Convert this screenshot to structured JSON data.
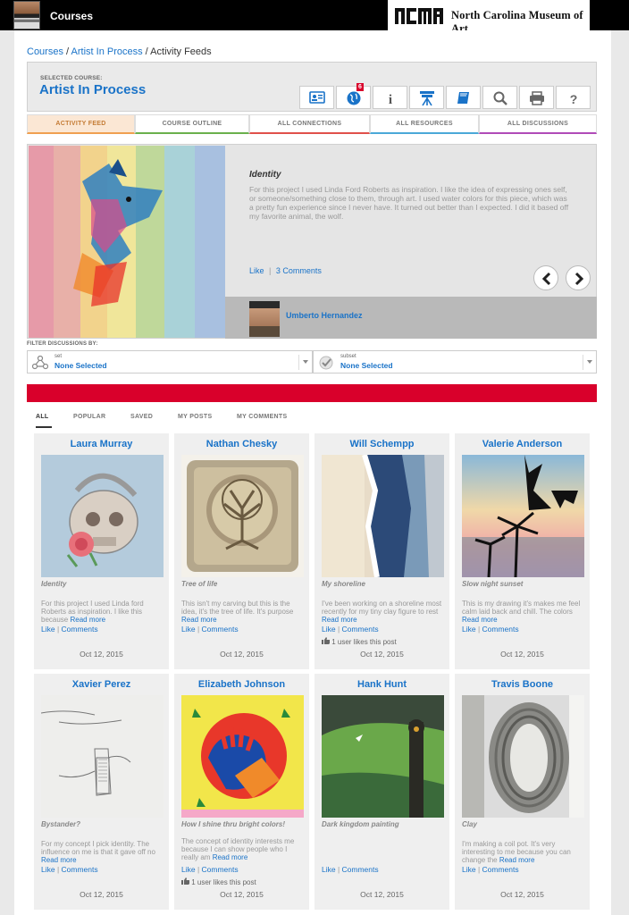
{
  "topbar": {
    "title": "Courses",
    "logo_text": "North Carolina Museum of Art"
  },
  "breadcrumb": {
    "item1": "Courses",
    "sep1": " / ",
    "item2": "Artist In Process",
    "sep2": " / ",
    "item3": "Activity Feeds"
  },
  "course": {
    "selected_label": "SELECTED COURSE:",
    "title": "Artist In Process",
    "badge_count": "6",
    "toolbar_icons": [
      "contact-card-icon",
      "globe-icon",
      "info-icon",
      "easel-icon",
      "book-icon",
      "search-icon",
      "print-icon",
      "help-icon"
    ],
    "help_glyph": "?",
    "info_glyph": "i"
  },
  "tabs": [
    "ACTIVITY FEED",
    "COURSE OUTLINE",
    "ALL CONNECTIONS",
    "ALL RESOURCES",
    "ALL DISCUSSIONS"
  ],
  "tab_colors": [
    "#f0a050",
    "#6ab04c",
    "#e0504a",
    "#4aa8d8",
    "#b04ab8"
  ],
  "feature": {
    "title": "Identity",
    "body": "For this project I used Linda Ford Roberts as inspiration. I like the idea of expressing ones self, or someone/something close to them, through art. I used water colors for this piece, which was a pretty fun experience since I never have. It turned out better than I expected. I did it based off my favorite animal, the wolf.",
    "like": "Like",
    "divider": "|",
    "comments": "3 Comments",
    "author": "Umberto Hernandez"
  },
  "filters": {
    "label": "FILTER DISCUSSIONS BY:",
    "set_small": "set",
    "set_value": "None Selected",
    "subset_small": "subset",
    "subset_value": "None Selected"
  },
  "subtabs": [
    "ALL",
    "POPULAR",
    "SAVED",
    "MY POSTS",
    "MY COMMENTS"
  ],
  "cards": [
    {
      "name": "Laura Murray",
      "title": "Identity",
      "body": "For this project I used Linda ford Roberts as inspiration. I like this because",
      "read_more": "Read more",
      "like": "Like",
      "comments": "Comments",
      "likes": "",
      "date": "Oct 12, 2015"
    },
    {
      "name": "Nathan Chesky",
      "title": "Tree of life",
      "body": "This isn't my carving but this is the idea, it's the tree of life. It's purpose",
      "read_more": "Read more",
      "like": "Like",
      "comments": "Comments",
      "likes": "",
      "date": "Oct 12, 2015"
    },
    {
      "name": "Will Schempp",
      "title": "My shoreline",
      "body": "I've been working on a shoreline most recently for my tiny clay figure to rest",
      "read_more": "Read more",
      "like": "Like",
      "comments": "Comments",
      "likes": "1 user likes this post",
      "date": "Oct 12, 2015"
    },
    {
      "name": "Valerie Anderson",
      "title": "Slow night sunset",
      "body": "This is my drawing it's makes me feel calm laid back and chill. The colors",
      "read_more": "Read more",
      "like": "Like",
      "comments": "Comments",
      "likes": "",
      "date": "Oct 12, 2015"
    },
    {
      "name": "Xavier Perez",
      "title": "Bystander?",
      "body": "For my concept I pick identity. The influence on me is that it gave off no",
      "read_more": "Read more",
      "like": "Like",
      "comments": "Comments",
      "likes": "",
      "date": "Oct 12, 2015"
    },
    {
      "name": "Elizabeth Johnson",
      "title": "How I shine thru bright colors!",
      "body": "The concept of identity interests me because I can show people who I really am",
      "read_more": "Read more",
      "like": "Like",
      "comments": "Comments",
      "likes": "1 user likes this post",
      "date": "Oct 12, 2015"
    },
    {
      "name": "Hank Hunt",
      "title": "Dark kingdom painting",
      "body": "",
      "read_more": "",
      "like": "Like",
      "comments": "Comments",
      "likes": "",
      "date": "Oct 12, 2015"
    },
    {
      "name": "Travis Boone",
      "title": "Clay",
      "body": "I'm making a coil pot. It's very interesting to me because you can change the",
      "read_more": "Read more",
      "like": "Like",
      "comments": "Comments",
      "likes": "",
      "date": "Oct 12, 2015"
    }
  ]
}
